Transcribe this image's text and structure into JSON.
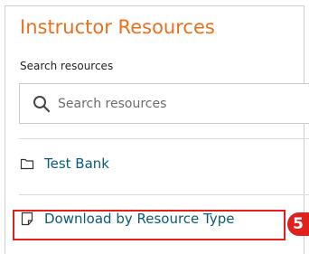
{
  "header": {
    "title": "Instructor Resources"
  },
  "search": {
    "label": "Search resources",
    "placeholder": "Search resources",
    "value": ""
  },
  "resources": [
    {
      "label": "Test Bank",
      "icon": "folder-icon"
    },
    {
      "label": "Download by Resource Type",
      "icon": "document-icon"
    }
  ],
  "annotation": {
    "step_number": "5",
    "color": "#e2201c"
  },
  "colors": {
    "title": "#e9711c",
    "link": "#0a5a78"
  }
}
